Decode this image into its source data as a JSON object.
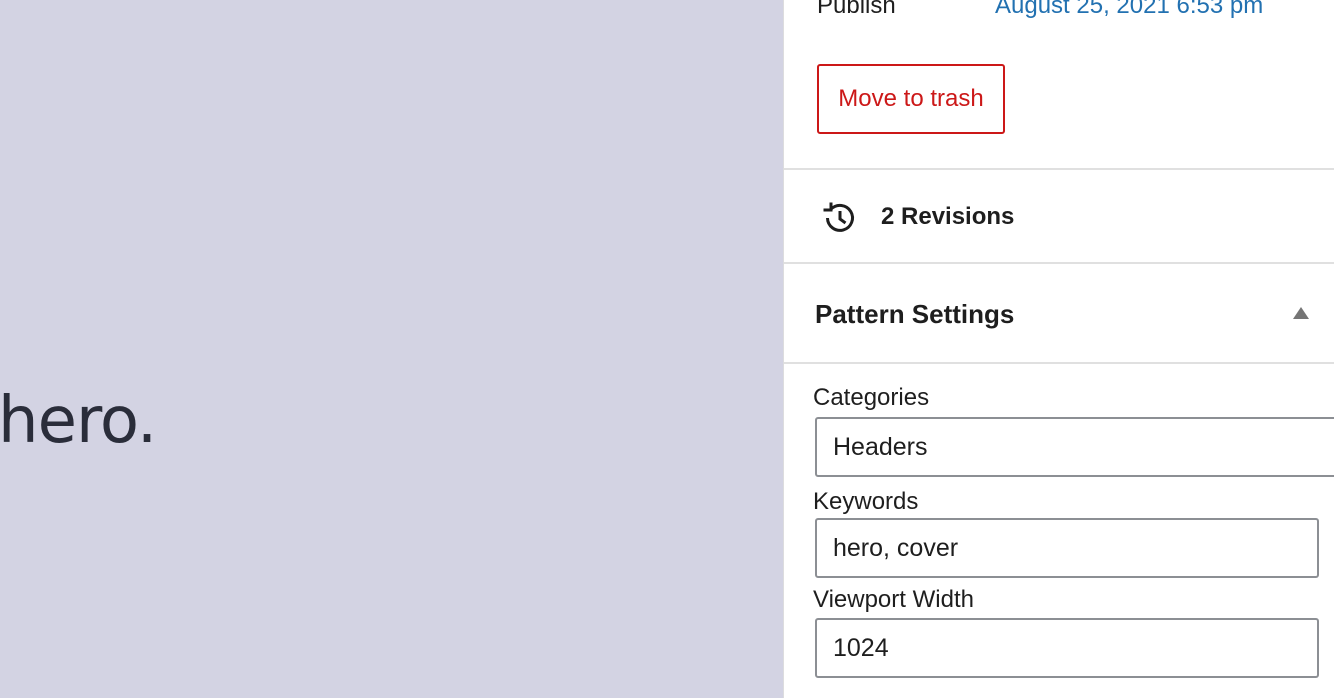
{
  "canvas": {
    "visible_text": "hero."
  },
  "sidebar": {
    "publish": {
      "label": "Publish",
      "date": "August 25, 2021 6:53 pm"
    },
    "trash_button": "Move to trash",
    "revisions": {
      "icon": "history-icon",
      "label": "2 Revisions"
    },
    "pattern_settings": {
      "title": "Pattern Settings",
      "toggle_icon": "caret-up-icon",
      "categories": {
        "label": "Categories",
        "value": "Headers"
      },
      "keywords": {
        "label": "Keywords",
        "value": "hero, cover"
      },
      "viewport_width": {
        "label": "Viewport Width",
        "value": "1024"
      }
    }
  },
  "colors": {
    "canvas_bg": "#d3d3e3",
    "link": "#2271b1",
    "destructive": "#cc1818"
  }
}
